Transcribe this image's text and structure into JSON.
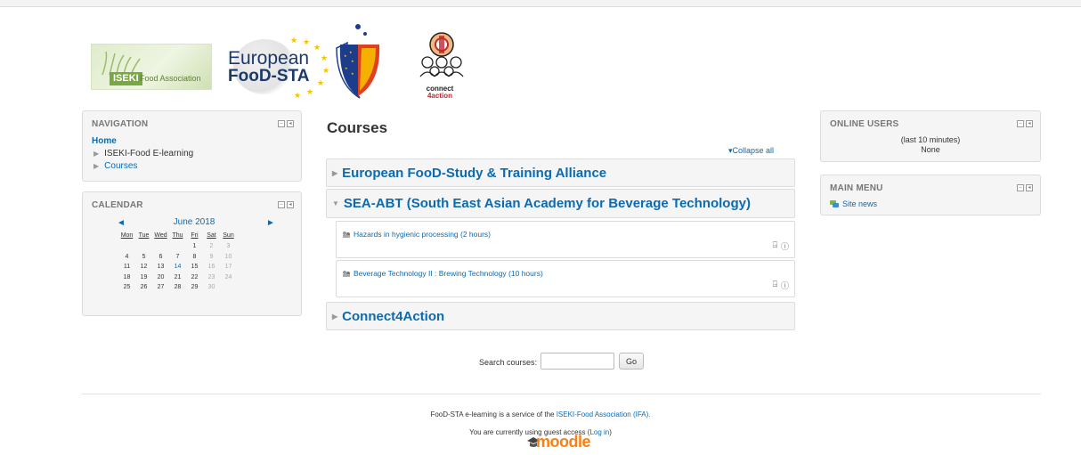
{
  "logos": {
    "iseki_tag": "ISEKI",
    "iseki_text": "Food Association",
    "foodsta_line1": "European",
    "foodsta_line2": "FooD-STA",
    "c4a_line1": "connect",
    "c4a_line2": "4action"
  },
  "navigation": {
    "title": "NAVIGATION",
    "home": "Home",
    "items": [
      "ISEKI-Food E-learning",
      "Courses"
    ]
  },
  "calendar": {
    "title": "CALENDAR",
    "month": "June 2018",
    "prev": "◄",
    "next": "►",
    "weekdays": [
      "Mon",
      "Tue",
      "Wed",
      "Thu",
      "Fri",
      "Sat",
      "Sun"
    ],
    "weeks": [
      [
        "",
        "",
        "",
        "",
        "1",
        "2",
        "3"
      ],
      [
        "4",
        "5",
        "6",
        "7",
        "8",
        "9",
        "10"
      ],
      [
        "11",
        "12",
        "13",
        "14",
        "15",
        "16",
        "17"
      ],
      [
        "18",
        "19",
        "20",
        "21",
        "22",
        "23",
        "24"
      ],
      [
        "25",
        "26",
        "27",
        "28",
        "29",
        "30",
        ""
      ]
    ],
    "today": "14"
  },
  "courses": {
    "title": "Courses",
    "collapse_all": "Collapse all",
    "categories": [
      "European FooD-Study & Training Alliance",
      "SEA-ABT (South East Asian Academy for Beverage Technology)",
      "Connect4Action"
    ],
    "course_items": [
      "Hazards in hygienic processing (2 hours)",
      "Beverage Technology II : Brewing Technology (10 hours)"
    ],
    "search_label": "Search courses:",
    "search_value": "",
    "go_label": "Go"
  },
  "online_users": {
    "title": "ONLINE USERS",
    "subtitle": "(last 10 minutes)",
    "value": "None"
  },
  "main_menu": {
    "title": "MAIN MENU",
    "site_news": "Site news"
  },
  "footer": {
    "service_prefix": "FooD-STA e-learning is a service of the ",
    "service_link": "ISEKI-Food Association (IFA).",
    "guest_text": "You are currently using guest access (",
    "login_link": "Log in",
    "guest_close": ")",
    "moodle": "moodle"
  },
  "colors": {
    "link": "#0b6bb0",
    "block_bg": "#f5f5f5",
    "moodle_orange": "#f98012"
  }
}
